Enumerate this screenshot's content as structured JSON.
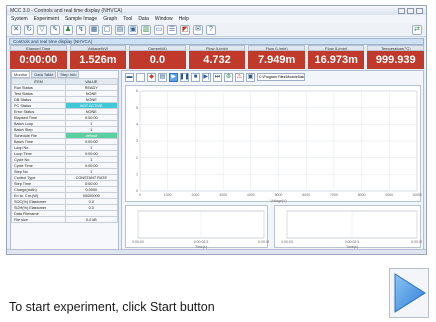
{
  "window": {
    "title": "MCC 3.0 - Controls and real time display (NHVCA)",
    "menu": [
      "System",
      "Experiment",
      "Sample Image",
      "Graph",
      "Tool",
      "Data",
      "Window",
      "Help"
    ]
  },
  "inner_window_title": "Controls and real time display (NHVCA)",
  "readouts": [
    {
      "label": "Elapsed Time",
      "value": "0:00:00",
      "color": "#c0392b"
    },
    {
      "label": "Voltage(kV)",
      "value": "1.526m",
      "color": "#c0392b"
    },
    {
      "label": "Current(A)",
      "value": "0.0",
      "color": "#c0392b"
    },
    {
      "label": "Flow (L/min)",
      "value": "4.732",
      "color": "#c0392b"
    },
    {
      "label": "Flow (L/min)",
      "value": "7.949m",
      "color": "#c0392b"
    },
    {
      "label": "Flow (L/min)",
      "value": "16.973m",
      "color": "#c0392b"
    },
    {
      "label": "Temperature(°C)",
      "value": "999.939",
      "color": "#c0392b"
    }
  ],
  "left_tabs": [
    "Monitor",
    "Data Table",
    "Step Info"
  ],
  "status_table": {
    "headers": [
      "ITEM",
      "VALUE"
    ],
    "rows": [
      [
        "Run Status",
        "READY"
      ],
      [
        "Test Status",
        "NONE"
      ],
      [
        "DB Status",
        "NONE"
      ],
      [
        "PC Status",
        "NOT ACTIVE"
      ],
      [
        "Error Status",
        "NONE"
      ],
      [
        "Elapsed Time",
        "0:00:00"
      ],
      [
        "Batch Loop",
        "1"
      ],
      [
        "Batch Step",
        "1"
      ],
      [
        "Schedule File",
        "default"
      ],
      [
        "Batch Time",
        "0:00:00"
      ],
      [
        "Loop No",
        "1"
      ],
      [
        "Loop Time",
        "0:00:00"
      ],
      [
        "Cycle No",
        "1"
      ],
      [
        "Cycle Time",
        "0:00:00"
      ],
      [
        "Step No",
        "1"
      ],
      [
        "Control Type",
        "CONSTANT RATE"
      ],
      [
        "Step Time",
        "0:00:00"
      ],
      [
        "Charge(mAh)",
        "0.0000"
      ],
      [
        "En to. Cnt.(W)",
        "00000000"
      ],
      [
        "SOC(%) Elastomer",
        "0.0"
      ],
      [
        "SOH(%) Elastomer",
        "0.0"
      ],
      [
        "Data Filename",
        ""
      ],
      [
        "File size",
        "0.0 kB"
      ]
    ]
  },
  "controls": {
    "file_combo": "C:\\Program Files\\ModuleData\\Recent_run_data.mcc"
  },
  "main_chart": {
    "y_ticks": [
      "0",
      "1",
      "2",
      "3",
      "4",
      "5",
      "6"
    ],
    "x_ticks": [
      "0",
      "1000",
      "2000",
      "3000",
      "4000",
      "5000",
      "6000",
      "7000",
      "8000",
      "9000",
      "10000"
    ],
    "xlabel": "Voltage(V)"
  },
  "sub_chart_left": {
    "x_ticks": [
      "0:00:00",
      "0:00:02.5",
      "0:00:05"
    ],
    "xlabel": "Time(s)"
  },
  "sub_chart_right": {
    "x_ticks": [
      "0:00:00",
      "0:00:02.5",
      "0:00:05"
    ],
    "xlabel": "Time(s)"
  },
  "instruction": {
    "text": "To start experiment, click Start button"
  },
  "colors": {
    "readout_bg": "#c0392b",
    "highlight_cyan": "#41c8d6",
    "play_blue": "#5fa0ea"
  },
  "icons": [
    "new-icon",
    "open-icon",
    "save-icon",
    "settings-icon",
    "play-icon",
    "pause-icon",
    "stop-icon",
    "chart-icon",
    "help-icon"
  ]
}
